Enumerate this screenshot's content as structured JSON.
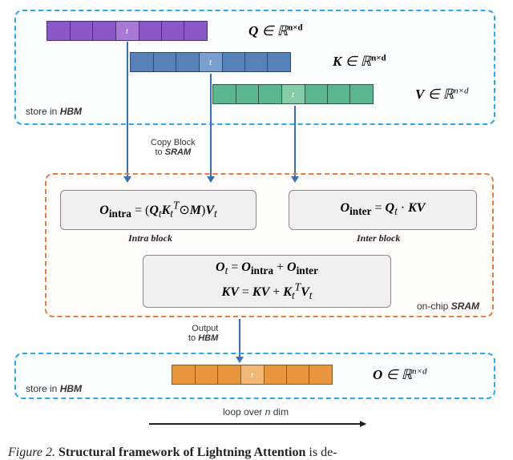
{
  "hbm": {
    "label_top": "store in <b><i>HBM</i></b>",
    "label_bottom": "store in <b><i>HBM</i></b>"
  },
  "sram": {
    "label": "on-chip <b><i>SRAM</i></b>"
  },
  "tensors": {
    "q_label": "<b><i>Q</i></b> ∈ ℝ<span class='sup'><b>n×d</b></span>",
    "k_label": "<b><i>K</i></b> ∈ ℝ<span class='sup'><b>n×d</b></span>",
    "v_label": "<b><i>V</i></b> ∈ ℝ<span class='sup'><i>n×d</i></span>",
    "o_label": "<b><i>O</i></b> ∈ ℝ<span class='sup'><i>n×d</i></span>",
    "t": "t"
  },
  "eq": {
    "intra": "<b><i>O</i></b><sub><b>intra</b></sub> = (<b><i>Q</i></b><sub><i>t</i></sub><b><i>K</i></b><sub><i>t</i></sub><sup><i>T</i></sup>⊙<b><i>M</i></b>)<b><i>V</i></b><sub><i>t</i></sub>",
    "intra_label": "Intra block",
    "inter": "<b><i>O</i></b><sub><b>inter</b></sub> = <b><i>Q</i></b><sub><i>t</i></sub> · <b><i>KV</i></b>",
    "inter_label": "Inter block",
    "update1": "<b><i>O</i></b><sub><i>t</i></sub> = <b><i>O</i></b><sub><b>intra</b></sub> + <b><i>O</i></b><sub><b>inter</b></sub>",
    "update2": "<b><i>KV</i></b> = <b><i>KV</i></b> + <b><i>K</i></b><sub><i>t</i></sub><sup><i>T</i></sup><b><i>V</i></b><sub><i>t</i></sub>"
  },
  "anno": {
    "copy": "Copy Block<br>to <b><i>SRAM</i></b>",
    "output": "Output<br>to <b><i>HBM</i></b>",
    "loop": "loop over <i>n</i> dim"
  },
  "caption": {
    "fignum": "Figure 2.",
    "title": "Structural framework of Lightning Attention",
    "rest": " is de-"
  }
}
